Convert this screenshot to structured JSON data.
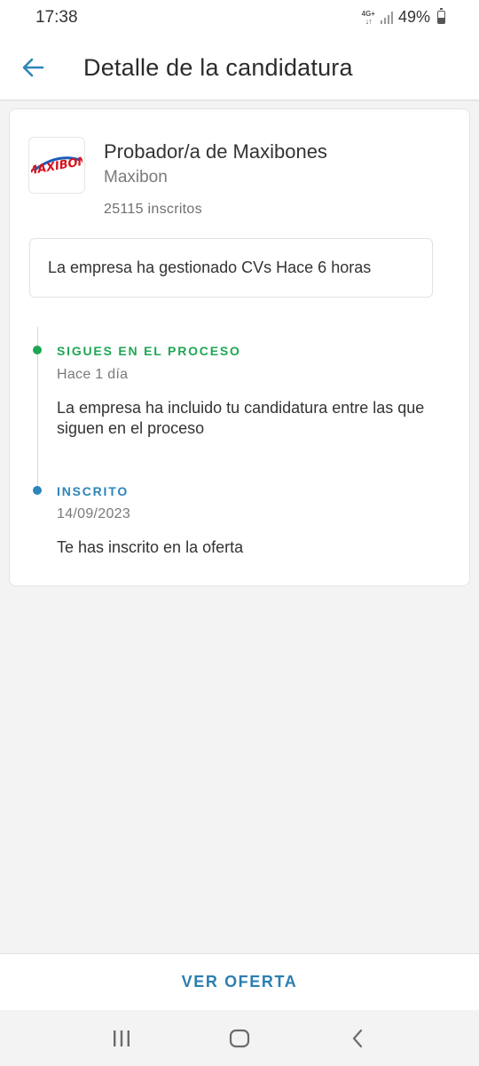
{
  "status_bar": {
    "time": "17:38",
    "network": "4G+",
    "battery_percent": "49%",
    "battery_level": 0.49
  },
  "app_bar": {
    "title": "Detalle de la candidatura",
    "back_icon": "arrow-left-icon",
    "accent_color": "#2b86b9"
  },
  "job": {
    "title": "Probador/a de Maxibones",
    "company": "Maxibon",
    "enrolled": "25115 inscritos",
    "logo_name": "maxibon-logo"
  },
  "notice": {
    "text": "La empresa ha gestionado CVs Hace 6 horas"
  },
  "timeline": [
    {
      "status": "SIGUES EN EL PROCESO",
      "status_color": "#1fa654",
      "time": "Hace 1 día",
      "description": "La empresa ha incluido tu candidatura entre las que siguen en el proceso"
    },
    {
      "status": "INSCRITO",
      "status_color": "#2b86b9",
      "time": "14/09/2023",
      "description": "Te has inscrito en la oferta"
    }
  ],
  "footer": {
    "action_label": "VER OFERTA"
  },
  "nav": {
    "recents_icon": "recents-icon",
    "home_icon": "home-icon",
    "back_icon": "chevron-left-icon"
  }
}
